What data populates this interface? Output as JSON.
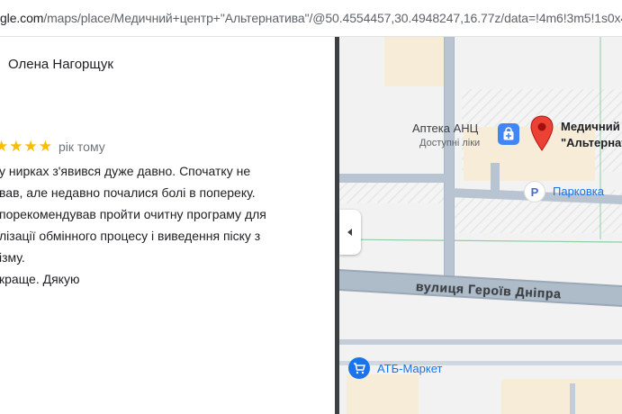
{
  "browser": {
    "url_host": "gle.com",
    "url_path": "/maps/place/Медичний+центр+\"Альтернатива\"/@50.4554457,30.4948247,16.77z/data=!4m6!3m5!1s0x4"
  },
  "review": {
    "reviewer_name": "Олена Нагорщук",
    "stars": 5,
    "date": "рік тому",
    "lines": [
      "у нирках з'явився дуже давно. Спочатку не",
      "вав, але недавно почалися болі в попереку.",
      "порекомендував пройти очитну програму для",
      "лізації обмінного процесу і виведення піску з",
      "ізму.",
      "краще. Дякую"
    ]
  },
  "map": {
    "pharmacy_name": "Аптека АНЦ",
    "pharmacy_subtitle": "Доступні ліки",
    "center_name_line1": "Медичний",
    "center_name_line2": "\"Альтернат",
    "parking_label": "Парковка",
    "parking_symbol": "P",
    "street_name": "вулиця Героїв Дніпра",
    "store_name": "АТБ-Маркет"
  },
  "colors": {
    "star": "#fbbc04",
    "marker": "#ea4335",
    "poi_blue": "#1a73e8",
    "pharmacy_blue": "#4285f4"
  },
  "icons": [
    "collapse-chevron-left-icon",
    "pharmacy-icon",
    "parking-icon",
    "shopping-cart-icon",
    "place-marker-icon"
  ]
}
